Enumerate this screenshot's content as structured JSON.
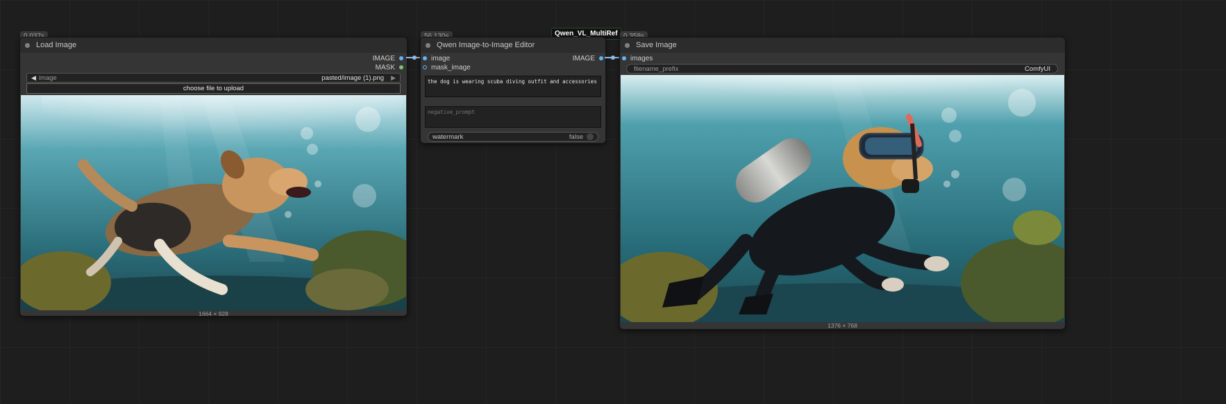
{
  "load_image": {
    "timer": "0.037s",
    "title": "Load Image",
    "outputs": [
      "IMAGE",
      "MASK"
    ],
    "widget_label": "image",
    "widget_value": "pasted/image (1).png",
    "upload_label": "choose file to upload",
    "image_size": "1664 × 928"
  },
  "qwen_editor": {
    "timer": "56.130s",
    "badge": "Qwen_VL_MultiRef",
    "title": "Qwen Image-to-Image Editor",
    "inputs": [
      "image",
      "mask_image"
    ],
    "output": "IMAGE",
    "prompt": "the dog is wearing scuba diving outfit and accessories",
    "negative_placeholder": "negative_prompt",
    "watermark_label": "watermark",
    "watermark_value": "false"
  },
  "save_image": {
    "timer": "0.358s",
    "title": "Save Image",
    "input": "images",
    "prefix_label": "filename_prefix",
    "prefix_value": "ComfyUI",
    "image_size": "1376 × 768"
  },
  "colors": {
    "canvas": "#1e1e1e",
    "node_body": "#353535",
    "node_title": "#2c2c2c",
    "image_link": "#64b5f6",
    "mask_link": "#7cc26b"
  },
  "icons": [
    "left-arrow-icon",
    "right-arrow-icon",
    "status-dot-icon"
  ]
}
